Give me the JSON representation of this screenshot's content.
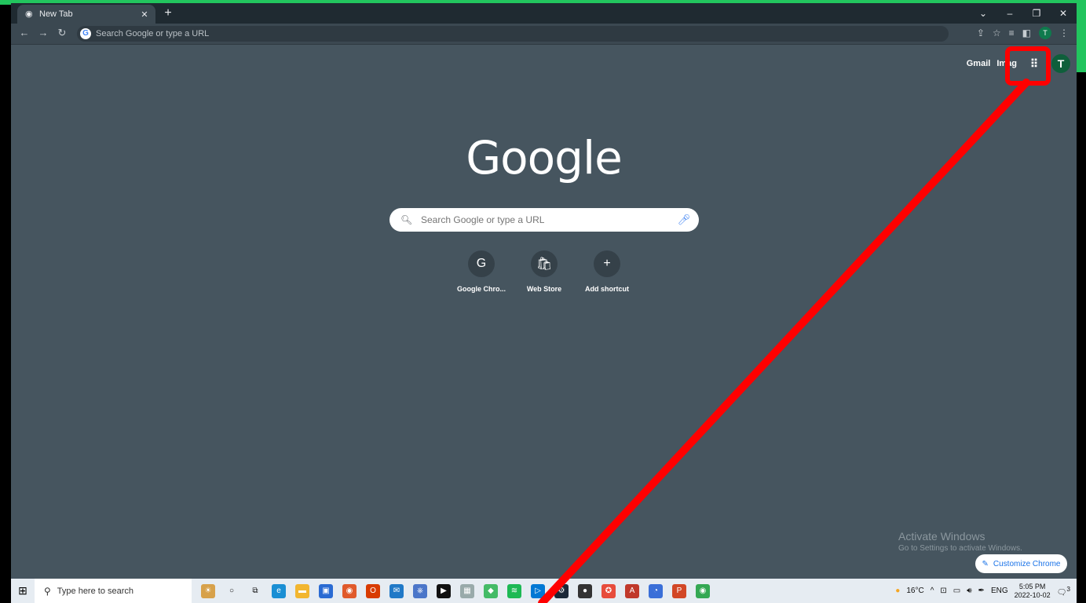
{
  "browser": {
    "tab_title": "New Tab",
    "omnibox_placeholder": "Search Google or type a URL"
  },
  "newtab": {
    "links": [
      "Gmail",
      "Imag"
    ],
    "avatar_letter": "T",
    "logo": "Google",
    "search_placeholder": "Search Google or type a URL",
    "shortcuts": [
      {
        "label": "Google Chro...",
        "icon": "G"
      },
      {
        "label": "Web Store",
        "icon": "🛍"
      },
      {
        "label": "Add shortcut",
        "icon": "+"
      }
    ],
    "activate_title": "Activate Windows",
    "activate_sub": "Go to Settings to activate Windows.",
    "customize_label": "Customize Chrome"
  },
  "taskbar": {
    "search_placeholder": "Type here to search",
    "weather": "16°C",
    "lang": "ENG",
    "time": "5:05 PM",
    "date": "2022-10-02",
    "notif_count": "3"
  },
  "colors": {
    "annotation": "#ff0000",
    "accent_green": "#22c55e"
  }
}
